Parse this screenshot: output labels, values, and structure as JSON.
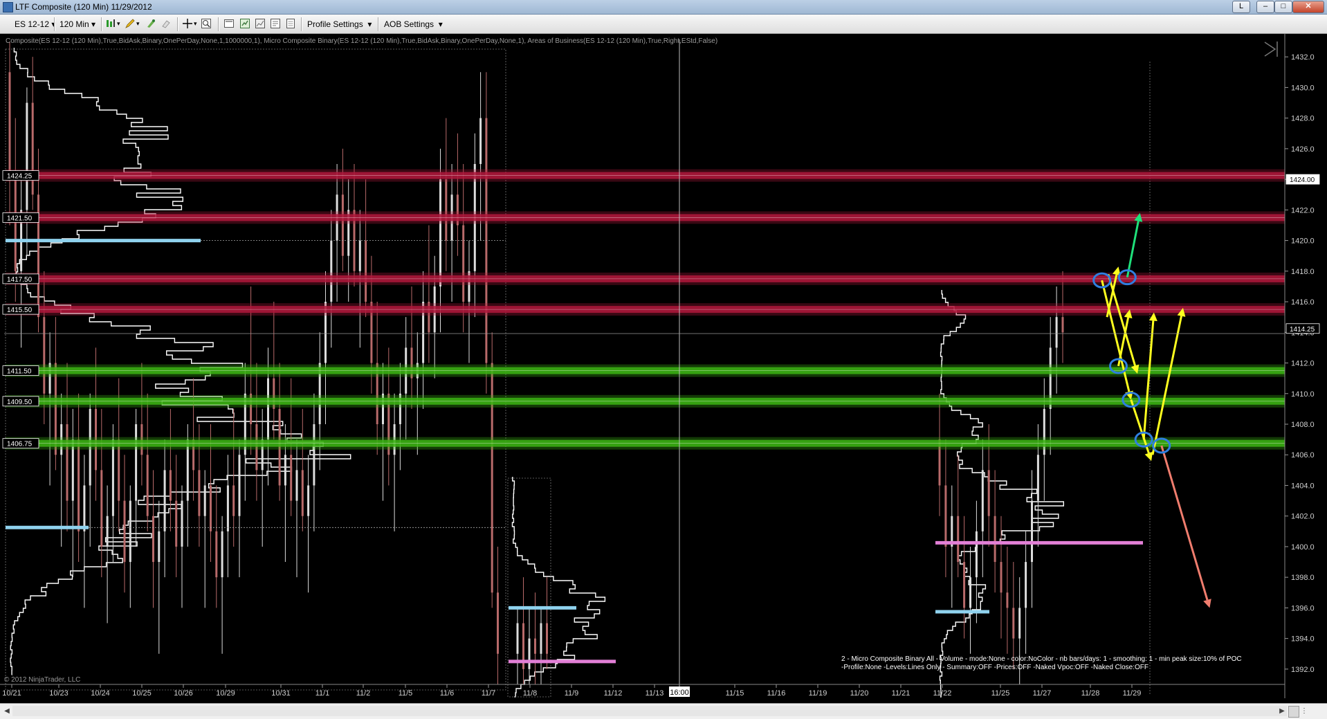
{
  "window": {
    "title": "LTF Composite (120 Min)  11/29/2012",
    "buttons": {
      "layout": "L",
      "minimize": "–",
      "maximize": "□",
      "close": "✕"
    }
  },
  "toolbar": {
    "instrument": "ES 12-12",
    "interval": "120 Min",
    "profile_settings": "Profile Settings",
    "aob_settings": "AOB Settings",
    "icons": [
      "bar-type-icon",
      "draw-pencil-icon",
      "marker-icon",
      "eraser-icon",
      "crosshair-icon",
      "zoom-icon",
      "data-box-icon",
      "chart-properties-icon",
      "strategy-icon",
      "template-icon",
      "notes-icon"
    ]
  },
  "chart_header": "Composite(ES 12-12 (120 Min),True,BidAsk,Binary,OnePerDay,None,1,1000000,1), Micro Composite Binary(ES 12-12 (120 Min),True,BidAsk,Binary,OnePerDay,None,1), Areas of Business(ES 12-12 (120 Min),True,Right,EStd,False)",
  "copyright": "© 2012 NinjaTrader, LLC",
  "info_line1": "2 - Micro Composite Binary All - Volume - mode:None - color:NoColor - nb bars/days: 1 - smoothing: 1 - min peak size:10% of POC",
  "info_line2": "-Profile:None -Levels:Lines Only - Summary:OFF -Prices:OFF -Naked Vpoc:OFF -Naked Close:OFF",
  "colors": {
    "background": "#000000",
    "resistance": "#b0183c",
    "support": "#3cb414",
    "poc_blue": "#8fd2ee",
    "poc_pink": "#e27fd6",
    "arrow_yellow": "#ffff1f",
    "arrow_green": "#1fe07a",
    "arrow_salmon": "#f07d6e",
    "circle_blue": "#2f7fe0"
  },
  "chart_data": {
    "type": "candlestick",
    "instrument": "ES 12-12",
    "timeframe": "120 Min",
    "ylim": [
      1391,
      1433.5
    ],
    "y_ticks": [
      1432,
      1430,
      1428,
      1426,
      1424,
      1422,
      1420,
      1418,
      1416,
      1414,
      1412,
      1410,
      1408,
      1406,
      1404,
      1402,
      1400,
      1398,
      1396,
      1394,
      1392
    ],
    "last_price_label": "1424.00",
    "crosshair_price_label": "1414.25",
    "crosshair_time_label": "16:00",
    "date_ticks": [
      "10/21",
      "10/23",
      "10/24",
      "10/25",
      "10/26",
      "10/29",
      "10/31",
      "11/1",
      "11/2",
      "11/5",
      "11/6",
      "11/7",
      "11/8",
      "11/9",
      "11/12",
      "11/13",
      "11/15",
      "11/16",
      "11/19",
      "11/20",
      "11/21",
      "11/22",
      "11/25",
      "11/27",
      "11/28",
      "11/29"
    ],
    "resistance_levels": [
      1424.25,
      1421.5,
      1417.5,
      1415.5
    ],
    "support_levels": [
      1411.5,
      1409.5,
      1406.75
    ],
    "level_labels": [
      "1424.25",
      "1421.50",
      "1417.50",
      "1415.50",
      "1411.50",
      "1409.50",
      "1406.75"
    ],
    "poc_lines": [
      {
        "color": "blue",
        "price": 1420.0
      },
      {
        "color": "blue",
        "price": 1401.25
      },
      {
        "color": "blue",
        "price": 1396.0
      },
      {
        "color": "pink",
        "price": 1392.5
      },
      {
        "color": "blue",
        "price": 1395.75
      },
      {
        "color": "pink",
        "price": 1400.25
      }
    ],
    "candles": [
      {
        "o": 1431,
        "h": 1433,
        "l": 1421,
        "c": 1424
      },
      {
        "o": 1424,
        "h": 1428,
        "l": 1416,
        "c": 1418
      },
      {
        "o": 1418,
        "h": 1424,
        "l": 1413,
        "c": 1422
      },
      {
        "o": 1422,
        "h": 1430,
        "l": 1419,
        "c": 1429
      },
      {
        "o": 1429,
        "h": 1432,
        "l": 1422,
        "c": 1423
      },
      {
        "o": 1423,
        "h": 1426,
        "l": 1414,
        "c": 1415
      },
      {
        "o": 1415,
        "h": 1418,
        "l": 1408,
        "c": 1410
      },
      {
        "o": 1410,
        "h": 1414,
        "l": 1404,
        "c": 1412
      },
      {
        "o": 1412,
        "h": 1415,
        "l": 1405,
        "c": 1406
      },
      {
        "o": 1406,
        "h": 1410,
        "l": 1400,
        "c": 1408
      },
      {
        "o": 1408,
        "h": 1412,
        "l": 1401,
        "c": 1403
      },
      {
        "o": 1403,
        "h": 1409,
        "l": 1398,
        "c": 1407
      },
      {
        "o": 1407,
        "h": 1410,
        "l": 1399,
        "c": 1401
      },
      {
        "o": 1401,
        "h": 1406,
        "l": 1396,
        "c": 1404
      },
      {
        "o": 1404,
        "h": 1410,
        "l": 1400,
        "c": 1409
      },
      {
        "o": 1409,
        "h": 1413,
        "l": 1403,
        "c": 1405
      },
      {
        "o": 1405,
        "h": 1409,
        "l": 1398,
        "c": 1400
      },
      {
        "o": 1400,
        "h": 1404,
        "l": 1395,
        "c": 1402
      },
      {
        "o": 1402,
        "h": 1408,
        "l": 1399,
        "c": 1407
      },
      {
        "o": 1407,
        "h": 1411,
        "l": 1401,
        "c": 1403
      },
      {
        "o": 1403,
        "h": 1406,
        "l": 1397,
        "c": 1399
      },
      {
        "o": 1399,
        "h": 1404,
        "l": 1396,
        "c": 1403
      },
      {
        "o": 1403,
        "h": 1409,
        "l": 1400,
        "c": 1408
      },
      {
        "o": 1408,
        "h": 1412,
        "l": 1404,
        "c": 1406
      },
      {
        "o": 1406,
        "h": 1410,
        "l": 1401,
        "c": 1402
      },
      {
        "o": 1402,
        "h": 1405,
        "l": 1396,
        "c": 1399
      },
      {
        "o": 1399,
        "h": 1403,
        "l": 1393,
        "c": 1401
      },
      {
        "o": 1401,
        "h": 1407,
        "l": 1398,
        "c": 1405
      },
      {
        "o": 1405,
        "h": 1409,
        "l": 1401,
        "c": 1403
      },
      {
        "o": 1403,
        "h": 1406,
        "l": 1398,
        "c": 1400
      },
      {
        "o": 1400,
        "h": 1404,
        "l": 1396,
        "c": 1403
      },
      {
        "o": 1403,
        "h": 1408,
        "l": 1400,
        "c": 1407
      },
      {
        "o": 1407,
        "h": 1411,
        "l": 1403,
        "c": 1405
      },
      {
        "o": 1405,
        "h": 1408,
        "l": 1400,
        "c": 1402
      },
      {
        "o": 1402,
        "h": 1405,
        "l": 1396,
        "c": 1404
      },
      {
        "o": 1404,
        "h": 1408,
        "l": 1399,
        "c": 1401
      },
      {
        "o": 1401,
        "h": 1404,
        "l": 1396,
        "c": 1398
      },
      {
        "o": 1398,
        "h": 1402,
        "l": 1393,
        "c": 1401
      },
      {
        "o": 1401,
        "h": 1406,
        "l": 1398,
        "c": 1404
      },
      {
        "o": 1404,
        "h": 1409,
        "l": 1400,
        "c": 1402
      },
      {
        "o": 1402,
        "h": 1407,
        "l": 1398,
        "c": 1406
      },
      {
        "o": 1406,
        "h": 1412,
        "l": 1403,
        "c": 1410
      },
      {
        "o": 1410,
        "h": 1417,
        "l": 1406,
        "c": 1408
      },
      {
        "o": 1408,
        "h": 1412,
        "l": 1403,
        "c": 1405
      },
      {
        "o": 1405,
        "h": 1409,
        "l": 1400,
        "c": 1407
      },
      {
        "o": 1407,
        "h": 1413,
        "l": 1404,
        "c": 1411
      },
      {
        "o": 1411,
        "h": 1416,
        "l": 1407,
        "c": 1409
      },
      {
        "o": 1409,
        "h": 1412,
        "l": 1403,
        "c": 1404
      },
      {
        "o": 1404,
        "h": 1408,
        "l": 1399,
        "c": 1406
      },
      {
        "o": 1406,
        "h": 1411,
        "l": 1402,
        "c": 1403
      },
      {
        "o": 1403,
        "h": 1407,
        "l": 1398,
        "c": 1405
      },
      {
        "o": 1405,
        "h": 1409,
        "l": 1401,
        "c": 1402
      },
      {
        "o": 1402,
        "h": 1406,
        "l": 1397,
        "c": 1404
      },
      {
        "o": 1404,
        "h": 1410,
        "l": 1401,
        "c": 1408
      },
      {
        "o": 1408,
        "h": 1414,
        "l": 1405,
        "c": 1412
      },
      {
        "o": 1412,
        "h": 1418,
        "l": 1408,
        "c": 1416
      },
      {
        "o": 1416,
        "h": 1422,
        "l": 1413,
        "c": 1420
      },
      {
        "o": 1420,
        "h": 1425,
        "l": 1416,
        "c": 1423
      },
      {
        "o": 1423,
        "h": 1426,
        "l": 1418,
        "c": 1419
      },
      {
        "o": 1419,
        "h": 1424,
        "l": 1416,
        "c": 1422
      },
      {
        "o": 1422,
        "h": 1425,
        "l": 1417,
        "c": 1418
      },
      {
        "o": 1418,
        "h": 1422,
        "l": 1413,
        "c": 1420
      },
      {
        "o": 1420,
        "h": 1424,
        "l": 1415,
        "c": 1416
      },
      {
        "o": 1416,
        "h": 1419,
        "l": 1410,
        "c": 1412
      },
      {
        "o": 1412,
        "h": 1416,
        "l": 1406,
        "c": 1408
      },
      {
        "o": 1408,
        "h": 1412,
        "l": 1403,
        "c": 1410
      },
      {
        "o": 1410,
        "h": 1413,
        "l": 1404,
        "c": 1406
      },
      {
        "o": 1406,
        "h": 1410,
        "l": 1401,
        "c": 1408
      },
      {
        "o": 1408,
        "h": 1412,
        "l": 1405,
        "c": 1410
      },
      {
        "o": 1410,
        "h": 1415,
        "l": 1407,
        "c": 1413
      },
      {
        "o": 1413,
        "h": 1417,
        "l": 1409,
        "c": 1411
      },
      {
        "o": 1411,
        "h": 1414,
        "l": 1406,
        "c": 1412
      },
      {
        "o": 1412,
        "h": 1418,
        "l": 1409,
        "c": 1416
      },
      {
        "o": 1416,
        "h": 1421,
        "l": 1412,
        "c": 1414
      },
      {
        "o": 1414,
        "h": 1419,
        "l": 1411,
        "c": 1417
      },
      {
        "o": 1417,
        "h": 1426,
        "l": 1414,
        "c": 1424
      },
      {
        "o": 1424,
        "h": 1428,
        "l": 1418,
        "c": 1420
      },
      {
        "o": 1420,
        "h": 1425,
        "l": 1416,
        "c": 1423
      },
      {
        "o": 1423,
        "h": 1427,
        "l": 1419,
        "c": 1421
      },
      {
        "o": 1421,
        "h": 1425,
        "l": 1414,
        "c": 1416
      },
      {
        "o": 1416,
        "h": 1420,
        "l": 1412,
        "c": 1418
      },
      {
        "o": 1418,
        "h": 1427,
        "l": 1415,
        "c": 1425
      },
      {
        "o": 1425,
        "h": 1431,
        "l": 1420,
        "c": 1428
      },
      {
        "o": 1428,
        "h": 1431,
        "l": 1410,
        "c": 1412
      },
      {
        "o": 1412,
        "h": 1414,
        "l": 1396,
        "c": 1397
      },
      {
        "o": 1397,
        "h": 1400,
        "l": 1391,
        "c": 1393
      },
      {
        "o": 1393,
        "h": 1396,
        "l": 1391,
        "c": 1395
      },
      {
        "o": 1395,
        "h": 1398,
        "l": 1391,
        "c": 1392
      },
      {
        "o": 1392,
        "h": 1396,
        "l": 1391,
        "c": 1394
      },
      {
        "o": 1394,
        "h": 1397,
        "l": 1391,
        "c": 1393
      },
      {
        "o": 1393,
        "h": 1396,
        "l": 1391,
        "c": 1395
      },
      {
        "o": 1395,
        "h": 1398,
        "l": 1392,
        "c": 1393
      },
      {
        "o": 1407,
        "h": 1410,
        "l": 1402,
        "c": 1404
      },
      {
        "o": 1404,
        "h": 1407,
        "l": 1398,
        "c": 1400
      },
      {
        "o": 1400,
        "h": 1404,
        "l": 1396,
        "c": 1402
      },
      {
        "o": 1402,
        "h": 1406,
        "l": 1398,
        "c": 1399
      },
      {
        "o": 1399,
        "h": 1402,
        "l": 1394,
        "c": 1396
      },
      {
        "o": 1396,
        "h": 1400,
        "l": 1393,
        "c": 1398
      },
      {
        "o": 1398,
        "h": 1403,
        "l": 1395,
        "c": 1401
      },
      {
        "o": 1401,
        "h": 1407,
        "l": 1398,
        "c": 1405
      },
      {
        "o": 1405,
        "h": 1408,
        "l": 1400,
        "c": 1402
      },
      {
        "o": 1402,
        "h": 1405,
        "l": 1397,
        "c": 1399
      },
      {
        "o": 1399,
        "h": 1402,
        "l": 1394,
        "c": 1397
      },
      {
        "o": 1397,
        "h": 1400,
        "l": 1393,
        "c": 1396
      },
      {
        "o": 1396,
        "h": 1399,
        "l": 1392,
        "c": 1394
      },
      {
        "o": 1394,
        "h": 1398,
        "l": 1391,
        "c": 1396
      },
      {
        "o": 1396,
        "h": 1401,
        "l": 1393,
        "c": 1399
      },
      {
        "o": 1399,
        "h": 1405,
        "l": 1396,
        "c": 1403
      },
      {
        "o": 1403,
        "h": 1408,
        "l": 1400,
        "c": 1406
      },
      {
        "o": 1406,
        "h": 1411,
        "l": 1403,
        "c": 1409
      },
      {
        "o": 1409,
        "h": 1415,
        "l": 1406,
        "c": 1413
      },
      {
        "o": 1413,
        "h": 1417,
        "l": 1410,
        "c": 1415
      },
      {
        "o": 1415,
        "h": 1418,
        "l": 1412,
        "c": 1414
      }
    ],
    "annotations": [
      {
        "type": "circle",
        "price": 1417.4,
        "t": 0.865
      },
      {
        "type": "circle",
        "price": 1417.6,
        "t": 0.885
      },
      {
        "type": "circle",
        "price": 1411.8,
        "t": 0.878
      },
      {
        "type": "circle",
        "price": 1409.6,
        "t": 0.888
      },
      {
        "type": "circle",
        "price": 1407.0,
        "t": 0.898
      },
      {
        "type": "circle",
        "price": 1406.6,
        "t": 0.912
      },
      {
        "type": "arrow",
        "color": "green",
        "from": [
          0.885,
          1417.6
        ],
        "to": [
          0.895,
          1421.8
        ]
      },
      {
        "type": "arrow",
        "color": "yellow",
        "from": [
          0.865,
          1417.4
        ],
        "to": [
          0.888,
          1409.6
        ]
      },
      {
        "type": "arrow",
        "color": "yellow",
        "from": [
          0.869,
          1415.0
        ],
        "to": [
          0.878,
          1418.3
        ]
      },
      {
        "type": "arrow",
        "color": "yellow",
        "from": [
          0.87,
          1417.8
        ],
        "to": [
          0.893,
          1411.3
        ]
      },
      {
        "type": "arrow",
        "color": "yellow",
        "from": [
          0.878,
          1411.8
        ],
        "to": [
          0.887,
          1415.5
        ]
      },
      {
        "type": "arrow",
        "color": "yellow",
        "from": [
          0.888,
          1409.6
        ],
        "to": [
          0.904,
          1405.6
        ]
      },
      {
        "type": "arrow",
        "color": "yellow",
        "from": [
          0.898,
          1407.0
        ],
        "to": [
          0.906,
          1415.3
        ]
      },
      {
        "type": "arrow",
        "color": "yellow",
        "from": [
          0.905,
          1406.0
        ],
        "to": [
          0.929,
          1415.6
        ]
      },
      {
        "type": "arrow",
        "color": "salmon",
        "from": [
          0.912,
          1406.6
        ],
        "to": [
          0.95,
          1396.0
        ]
      }
    ]
  }
}
